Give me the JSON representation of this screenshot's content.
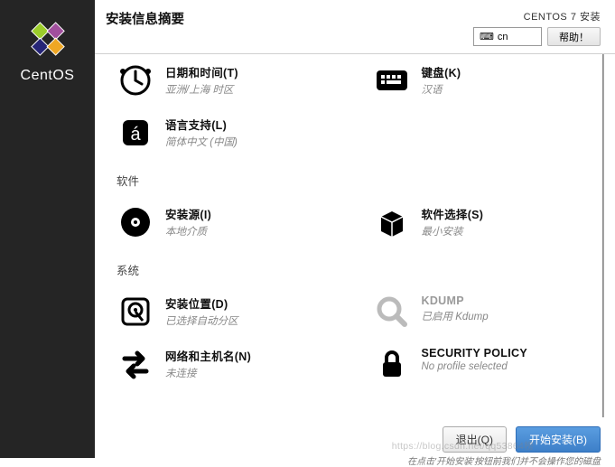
{
  "brand": "CentOS",
  "header": {
    "title": "安装信息摘要",
    "subtitle": "CENTOS 7 安装",
    "keyboard_layout": "cn",
    "help_label": "帮助！"
  },
  "sections": {
    "localization": {
      "items": [
        {
          "icon": "clock",
          "title": "日期和时间(T)",
          "status": "亚洲/上海 时区"
        },
        {
          "icon": "keyboard",
          "title": "键盘(K)",
          "status": "汉语"
        },
        {
          "icon": "lang",
          "title": "语言支持(L)",
          "status": "简体中文 (中国)"
        }
      ]
    },
    "software": {
      "heading": "软件",
      "items": [
        {
          "icon": "disc",
          "title": "安装源(I)",
          "status": "本地介质"
        },
        {
          "icon": "software",
          "title": "软件选择(S)",
          "status": "最小安装"
        }
      ]
    },
    "system": {
      "heading": "系统",
      "items": [
        {
          "icon": "disk",
          "title": "安装位置(D)",
          "status": "已选择自动分区"
        },
        {
          "icon": "kdump",
          "title": "KDUMP",
          "status": "已启用 Kdump",
          "dim": true
        },
        {
          "icon": "network",
          "title": "网络和主机名(N)",
          "status": "未连接"
        },
        {
          "icon": "security",
          "title": "SECURITY POLICY",
          "status": "No profile selected"
        }
      ]
    }
  },
  "footer": {
    "quit_label": "退出(Q)",
    "begin_label": "开始安装(B)",
    "hint": "在点击'开始安装'按钮前我们并不会操作您的磁盘"
  },
  "watermark": "https://blog.csdn.net/qq53864榜"
}
